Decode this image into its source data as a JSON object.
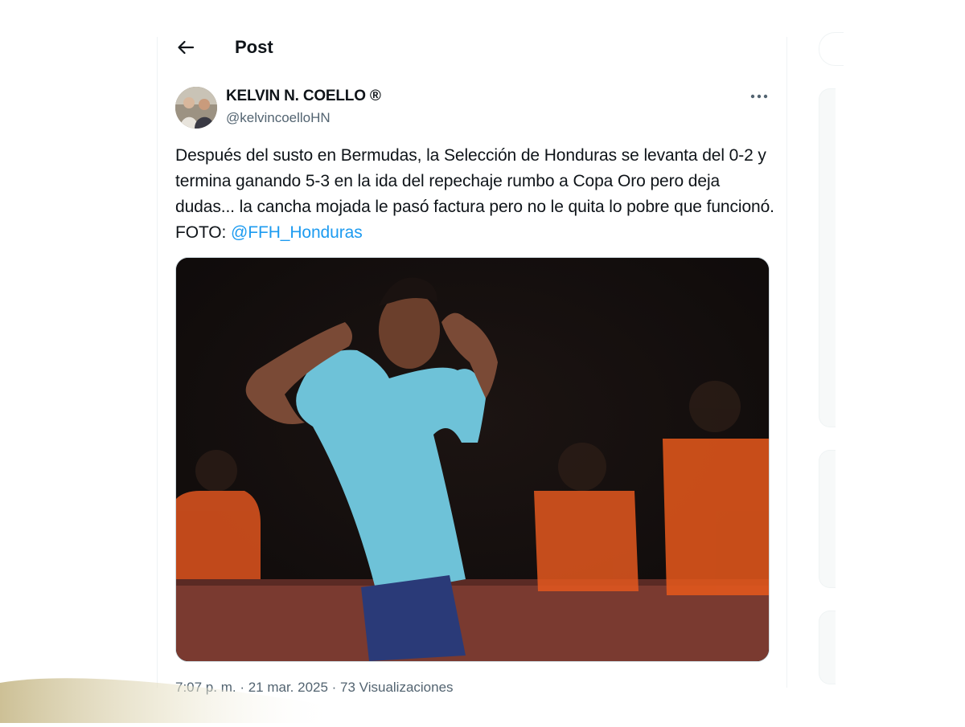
{
  "header": {
    "title": "Post",
    "back_icon": "arrow-left-icon"
  },
  "tweet": {
    "author_name": "KELVIN N. COELLO ®",
    "author_handle": "@kelvincoelloHN",
    "more_icon": "more-horizontal-icon",
    "text": "Después del susto en Bermudas, la Selección de Honduras se levanta del 0-2 y termina ganando 5-3 en la ida del repechaje rumbo a Copa Oro pero deja dudas... la cancha mojada le pasó factura pero no le quita lo pobre que funcionó. FOTO: ",
    "mention": "@FFH_Honduras",
    "meta_line": "7:07 p. m. · 21 mar. 2025 · 73 Visualizaciones"
  },
  "colors": {
    "link": "#1d9bf0",
    "secondary_text": "#536471",
    "primary_text": "#0f1419",
    "border": "#eff3f4"
  }
}
